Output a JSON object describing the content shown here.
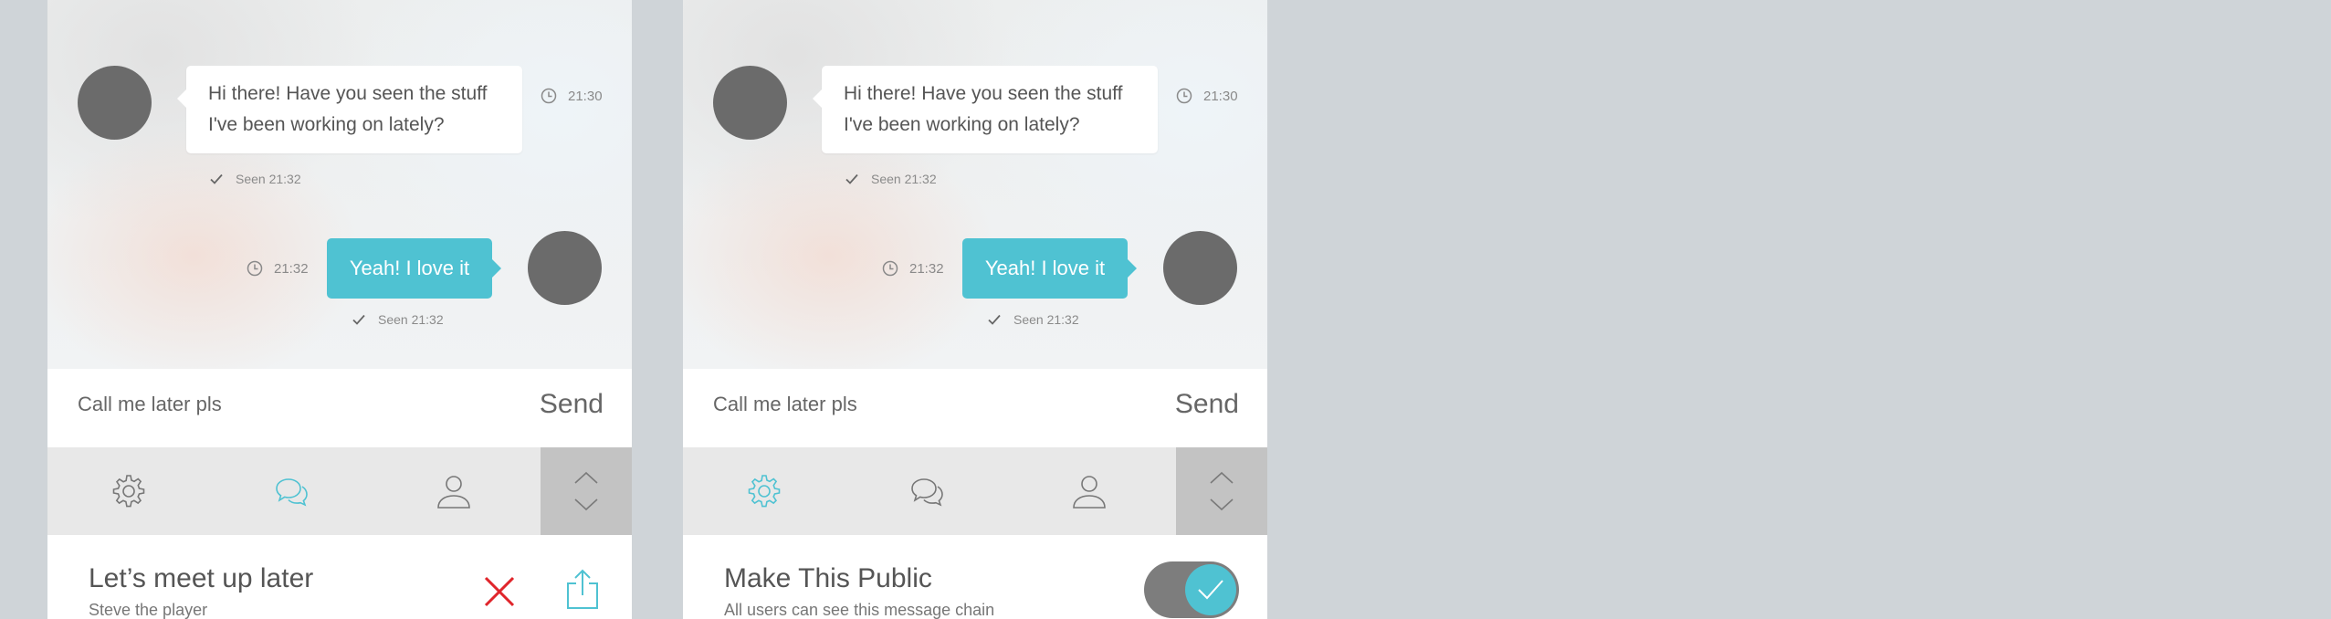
{
  "panels": [
    {
      "chat": {
        "incoming": {
          "text_line1": "Hi there! Have you seen the stuff",
          "text_line2": "I've been working on lately?",
          "time": "21:30",
          "seen": "Seen 21:32"
        },
        "outgoing": {
          "text": "Yeah! I love it",
          "time": "21:32",
          "seen": "Seen 21:32"
        }
      },
      "composer": {
        "input_value": "Call me later pls",
        "send_label": "Send"
      },
      "tabs": [
        {
          "icon": "gear-icon",
          "active": false
        },
        {
          "icon": "chat-bubbles-icon",
          "active": true
        },
        {
          "icon": "user-icon",
          "active": false
        }
      ],
      "footer": {
        "title": "Let’s meet up later",
        "subtitle": "Steve the player"
      }
    },
    {
      "chat": {
        "incoming": {
          "text_line1": "Hi there! Have you seen the stuff",
          "text_line2": "I've been working on lately?",
          "time": "21:30",
          "seen": "Seen 21:32"
        },
        "outgoing": {
          "text": "Yeah! I love it",
          "time": "21:32",
          "seen": "Seen 21:32"
        }
      },
      "composer": {
        "input_value": "Call me later pls",
        "send_label": "Send"
      },
      "tabs": [
        {
          "icon": "gear-icon",
          "active": true
        },
        {
          "icon": "chat-bubbles-icon",
          "active": false
        },
        {
          "icon": "user-icon",
          "active": false
        }
      ],
      "footer": {
        "title": "Make This Public",
        "subtitle": "All users can see this message chain",
        "toggle_on": true
      }
    }
  ],
  "colors": {
    "accent": "#4fc2d2",
    "avatar": "#6b6b6b",
    "delete": "#e0252b",
    "background": "#cfd4d8"
  }
}
